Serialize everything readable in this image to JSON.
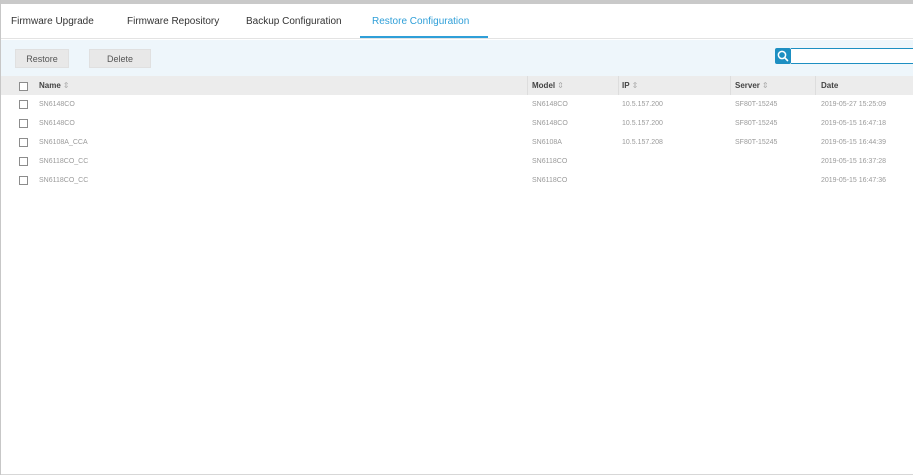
{
  "tabs": [
    {
      "label": "Firmware Upgrade",
      "active": false
    },
    {
      "label": "Firmware Repository",
      "active": false
    },
    {
      "label": "Backup Configuration",
      "active": false
    },
    {
      "label": "Restore Configuration",
      "active": true
    }
  ],
  "toolbar": {
    "restore_label": "Restore",
    "delete_label": "Delete",
    "search_value": "",
    "search_icon": "search-icon"
  },
  "table": {
    "columns": [
      "Name",
      "Model",
      "IP",
      "Server",
      "Date"
    ],
    "rows": [
      [
        "SN6148CO",
        "SN6148CO",
        "10.5.157.200",
        "SF80T-15245",
        "2019-05-27 15:25:09"
      ],
      [
        "SN6148CO",
        "SN6148CO",
        "10.5.157.200",
        "SF80T-15245",
        "2019-05-15 16:47:18"
      ],
      [
        "SN6108A_CCA",
        "SN6108A",
        "10.5.157.208",
        "SF80T-15245",
        "2019-05-15 16:44:39"
      ],
      [
        "SN6118CO_CC",
        "SN6118CO",
        "",
        "",
        "2019-05-15 16:37:28"
      ],
      [
        "SN6118CO_CC",
        "SN6118CO",
        "",
        "",
        "2019-05-15 16:47:36"
      ]
    ]
  },
  "colors": {
    "accent": "#2f9fd8",
    "search_button": "#1d8fc2"
  }
}
